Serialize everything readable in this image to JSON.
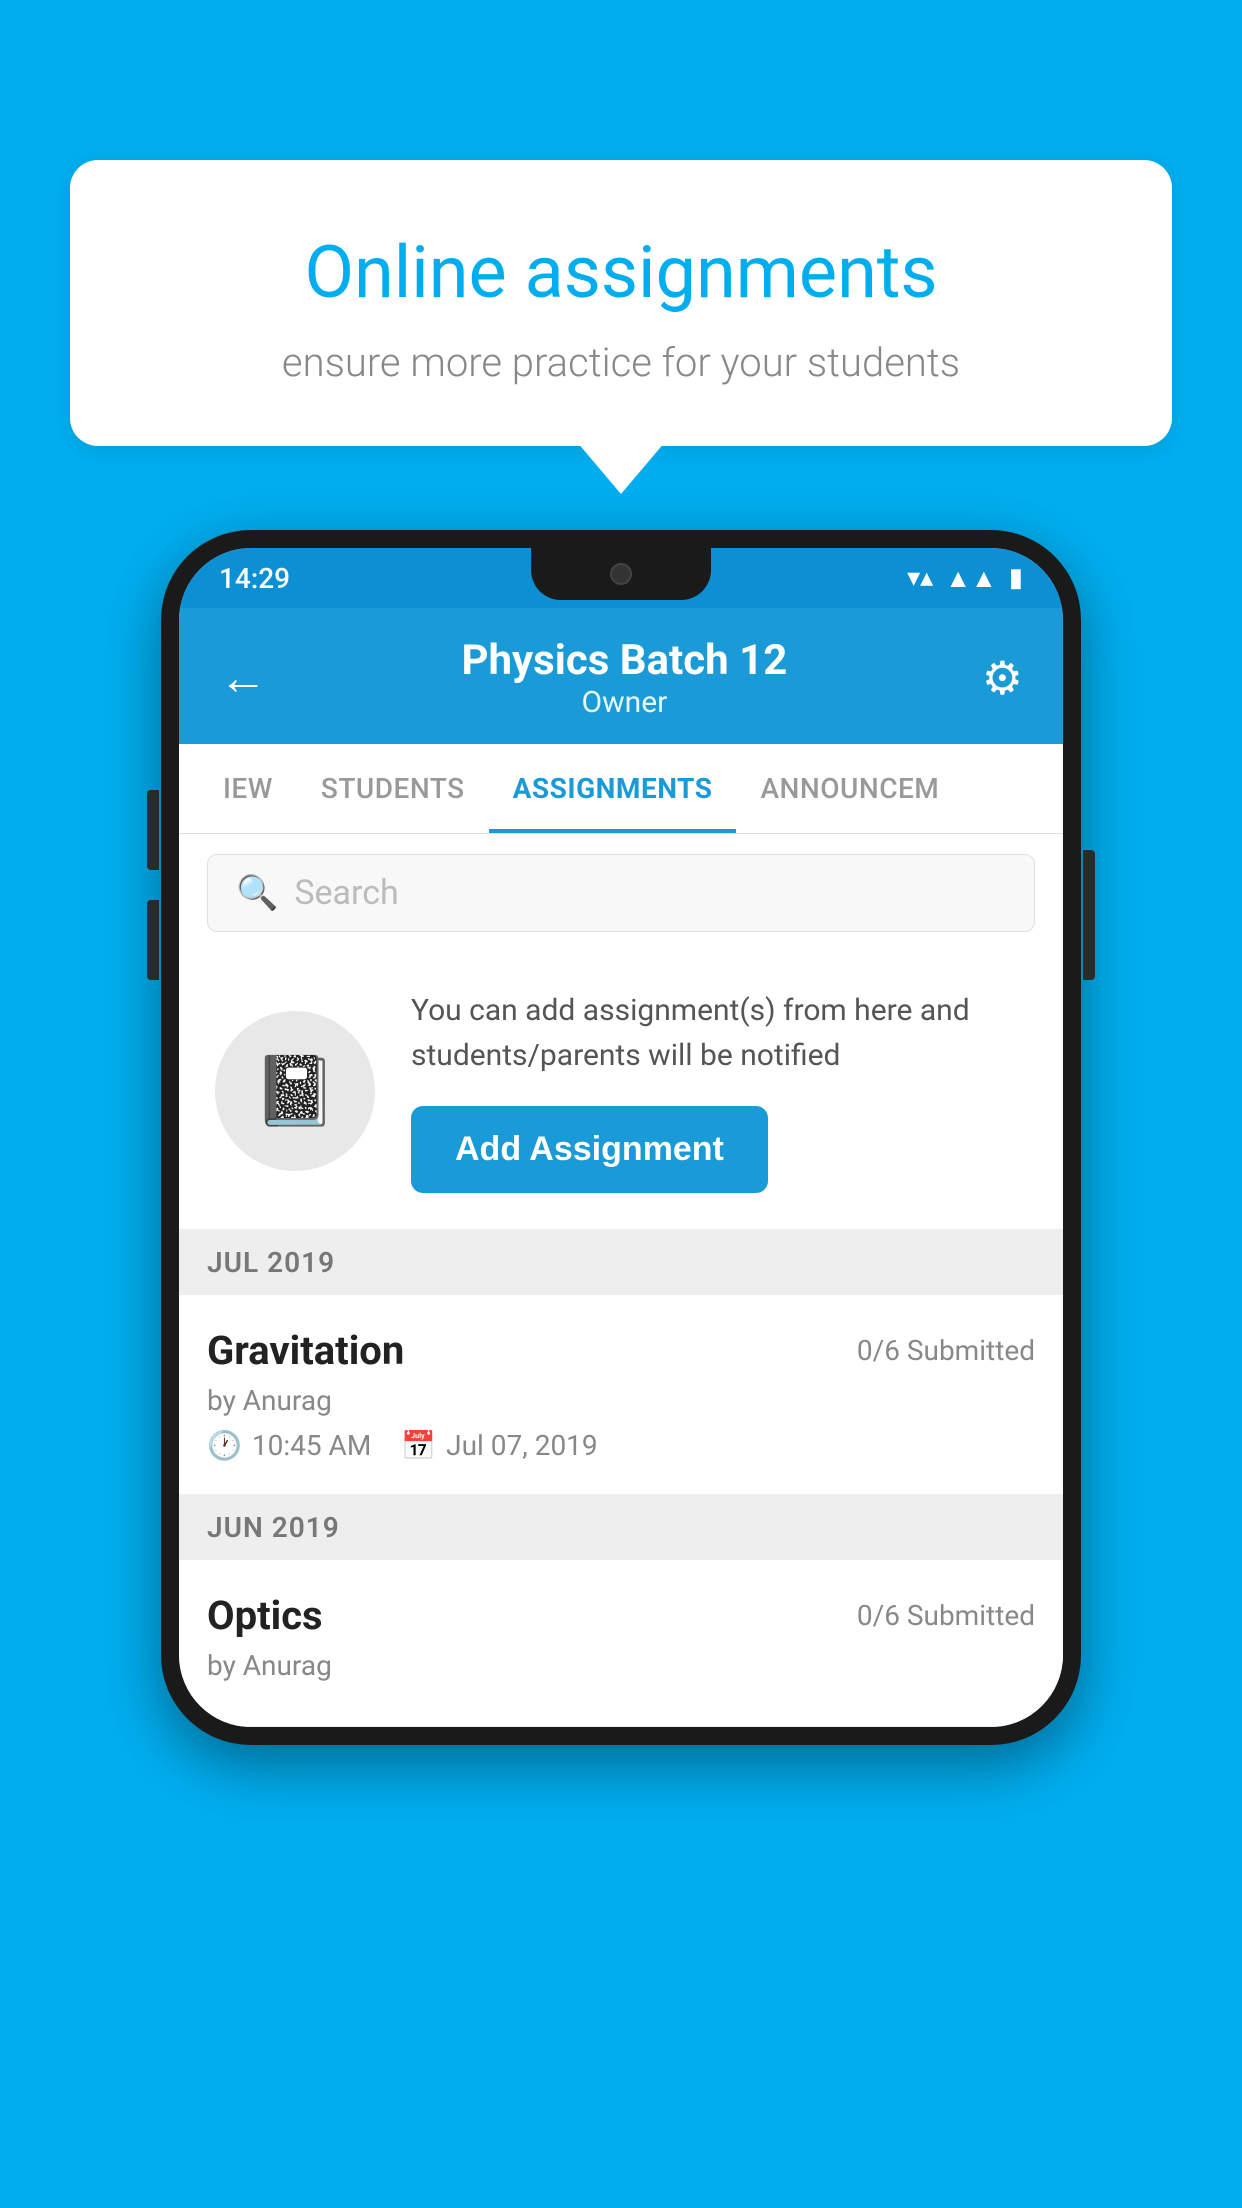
{
  "background_color": "#00AEEF",
  "speech_bubble": {
    "title": "Online assignments",
    "subtitle": "ensure more practice for your students"
  },
  "phone": {
    "status_bar": {
      "time": "14:29",
      "wifi_icon": "wifi",
      "signal_icon": "signal",
      "battery_icon": "battery"
    },
    "header": {
      "title": "Physics Batch 12",
      "subtitle": "Owner",
      "back_label": "←",
      "settings_icon": "⚙"
    },
    "tabs": [
      {
        "label": "IEW",
        "active": false
      },
      {
        "label": "STUDENTS",
        "active": false
      },
      {
        "label": "ASSIGNMENTS",
        "active": true
      },
      {
        "label": "ANNOUNCEM",
        "active": false
      }
    ],
    "search": {
      "placeholder": "Search"
    },
    "info_card": {
      "description": "You can add assignment(s) from here and students/parents will be notified",
      "button_label": "Add Assignment"
    },
    "sections": [
      {
        "label": "JUL 2019",
        "assignments": [
          {
            "name": "Gravitation",
            "submitted": "0/6 Submitted",
            "by": "by Anurag",
            "time": "10:45 AM",
            "date": "Jul 07, 2019"
          }
        ]
      },
      {
        "label": "JUN 2019",
        "assignments": [
          {
            "name": "Optics",
            "submitted": "0/6 Submitted",
            "by": "by Anurag",
            "time": "",
            "date": ""
          }
        ]
      }
    ]
  }
}
